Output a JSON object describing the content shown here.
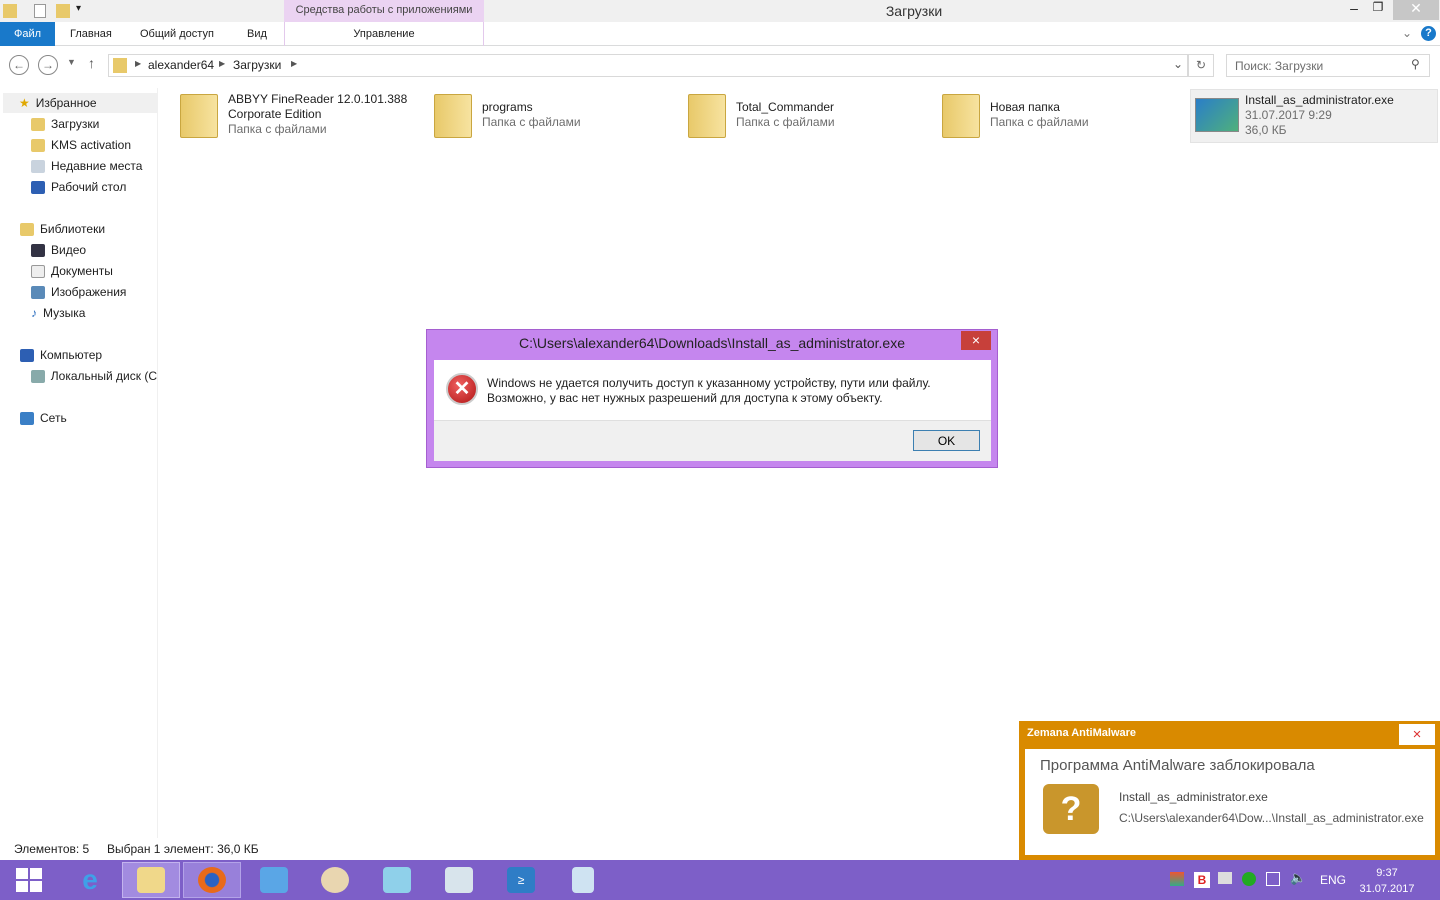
{
  "window": {
    "title": "Загрузки",
    "context_tab_group": "Средства работы с приложениями"
  },
  "ribbon": {
    "tabs": [
      "Файл",
      "Главная",
      "Общий доступ",
      "Вид",
      "Управление"
    ]
  },
  "address": {
    "crumbs": [
      "alexander64",
      "Загрузки"
    ],
    "search_placeholder": "Поиск: Загрузки"
  },
  "sidebar": {
    "favorites": {
      "label": "Избранное",
      "items": [
        "Загрузки",
        "KMS activation",
        "Недавние места",
        "Рабочий стол"
      ]
    },
    "libraries": {
      "label": "Библиотеки",
      "items": [
        "Видео",
        "Документы",
        "Изображения",
        "Музыка"
      ]
    },
    "computer": {
      "label": "Компьютер",
      "items": [
        "Локальный диск (C"
      ]
    },
    "network": {
      "label": "Сеть"
    }
  },
  "files": [
    {
      "name": "ABBYY FineReader 12.0.101.388",
      "name2": "Corporate Edition",
      "sub": "Папка с файлами"
    },
    {
      "name": "programs",
      "sub": "Папка с файлами"
    },
    {
      "name": "Total_Commander",
      "sub": "Папка с файлами"
    },
    {
      "name": "Новая папка",
      "sub": "Папка с файлами"
    },
    {
      "name": "Install_as_administrator.exe",
      "date": "31.07.2017 9:29",
      "size": "36,0 КБ"
    }
  ],
  "status": {
    "count": "Элементов: 5",
    "selected": "Выбран 1 элемент: 36,0 КБ"
  },
  "dialog": {
    "title": "C:\\Users\\alexander64\\Downloads\\Install_as_administrator.exe",
    "line1": "Windows не удается получить доступ к указанному устройству, пути или файлу.",
    "line2": "Возможно, у вас нет нужных разрешений для доступа к этому объекту.",
    "ok": "OK",
    "close": "×"
  },
  "toast": {
    "app": "Zemana AntiMalware",
    "heading": "Программа AntiMalware заблокировала",
    "file": "Install_as_administrator.exe",
    "path": "C:\\Users\\alexander64\\Dow...\\Install_as_administrator.exe",
    "icon_glyph": "?",
    "close": "×"
  },
  "tray": {
    "lang": "ENG",
    "time": "9:37",
    "date": "31.07.2017",
    "badge": "B"
  },
  "colors": {
    "taskbar": "#7d5fc8",
    "dialog_frame": "#c586ee",
    "toast": "#d98a00",
    "file_tab": "#1979ca"
  }
}
